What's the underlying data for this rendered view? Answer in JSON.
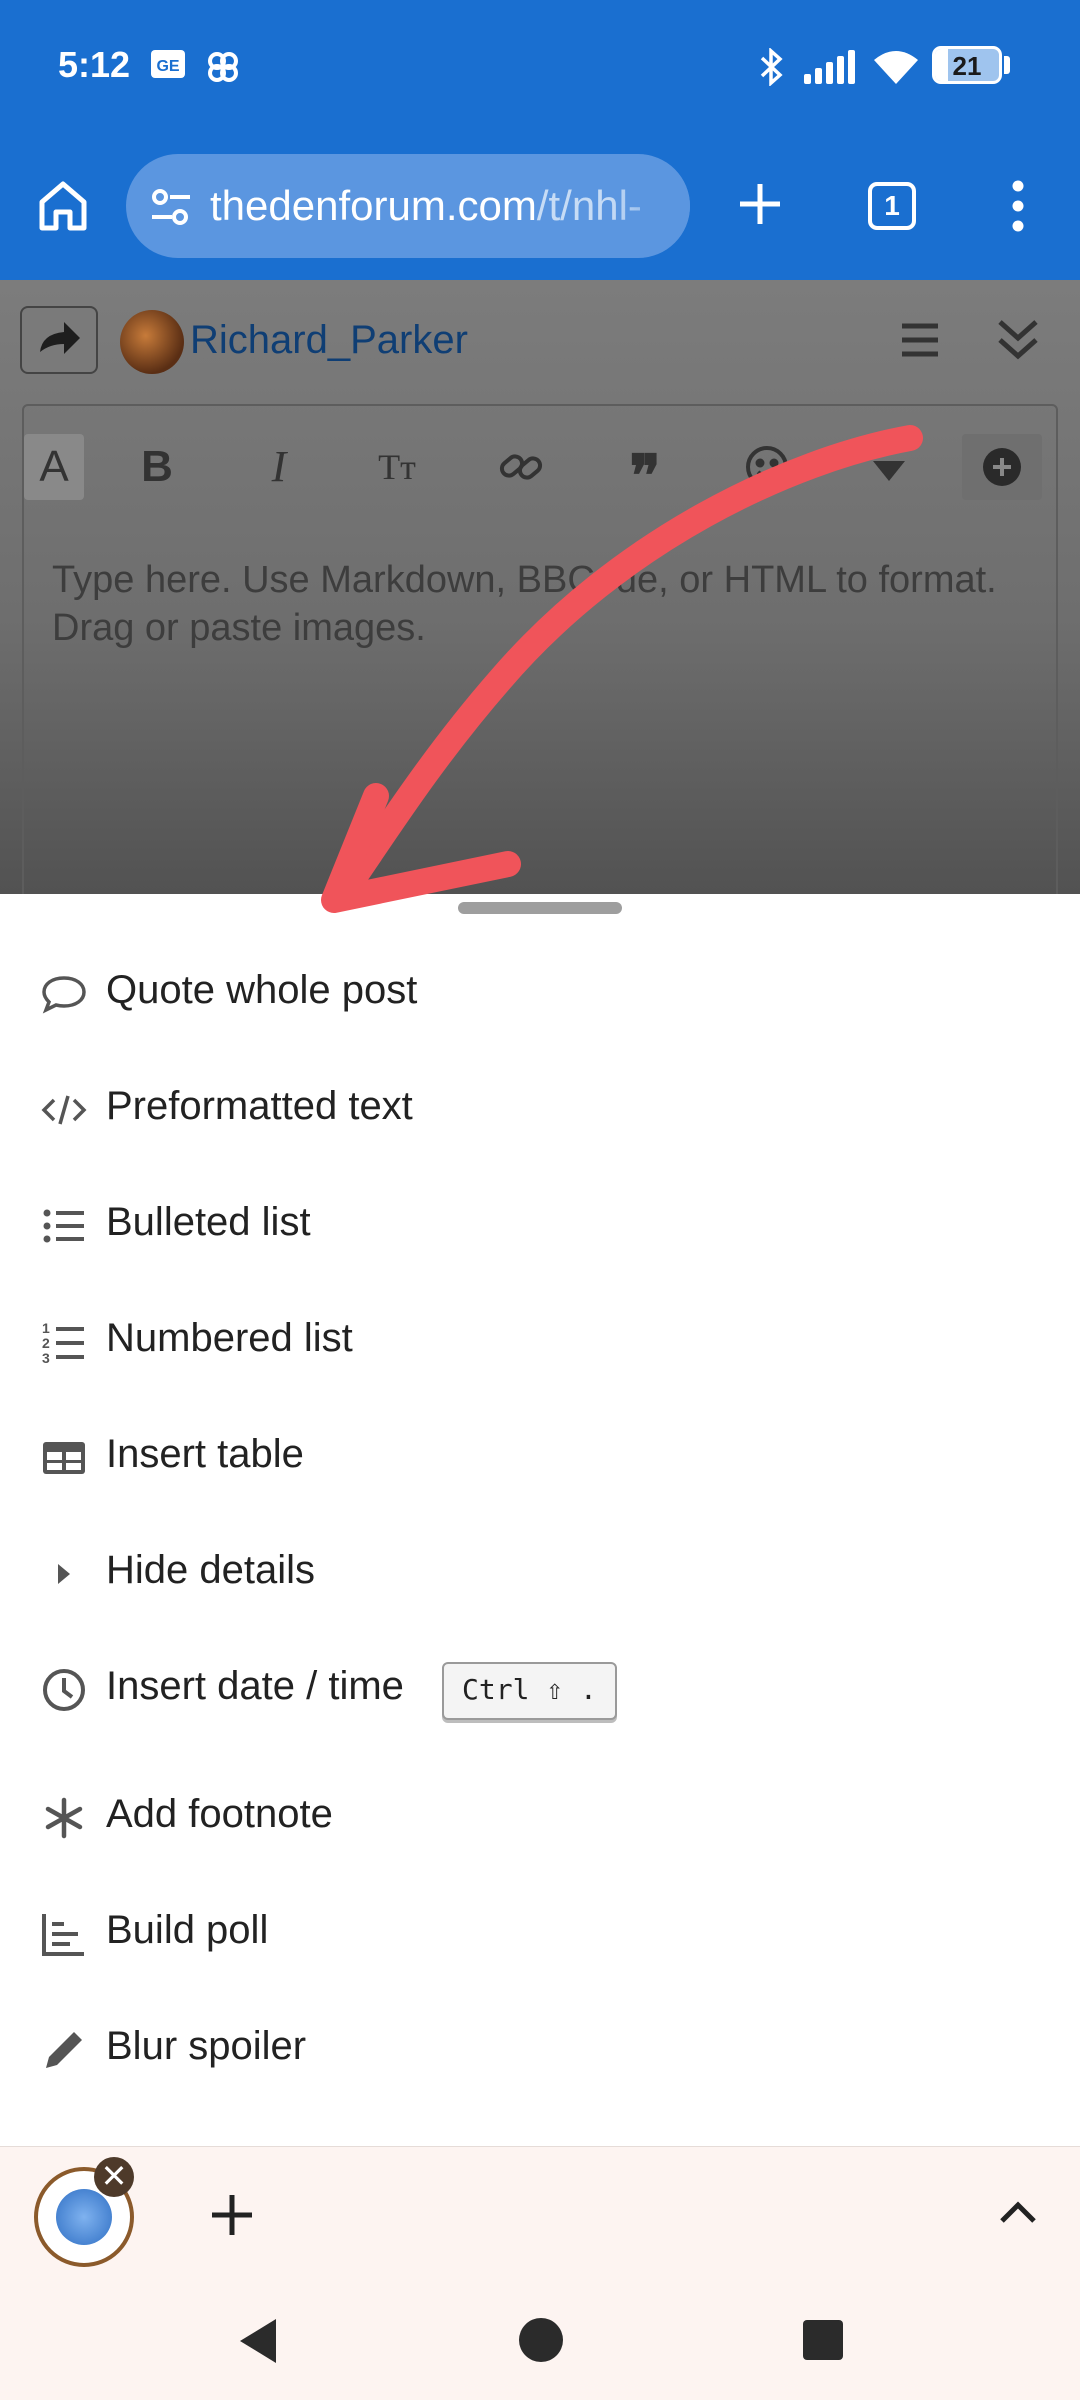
{
  "status_bar": {
    "time": "5:12",
    "battery_level": "21",
    "battery_fraction": 0.21,
    "icons": [
      "gmail-icon",
      "pinwheel-icon",
      "bluetooth-icon",
      "signal-icon",
      "wifi-icon",
      "battery-icon"
    ]
  },
  "browser": {
    "url_domain": "thedenforum.com",
    "url_path": "/t/nhl-",
    "tab_count": "1",
    "colors": {
      "toolbar": "#1a6fd0",
      "urlbar": "#5b96e0"
    }
  },
  "composer": {
    "username": "Richard_Parker",
    "placeholder": "Type here. Use Markdown, BBCode, or HTML to format. Drag or paste images.",
    "toolbar_buttons": [
      "font-size",
      "bold",
      "italic",
      "heading",
      "link",
      "blockquote",
      "emoji",
      "gear",
      "options"
    ]
  },
  "menu": {
    "items": [
      {
        "label": "Quote whole post",
        "icon": "speech-bubble-icon"
      },
      {
        "label": "Preformatted text",
        "icon": "code-icon"
      },
      {
        "label": "Bulleted list",
        "icon": "bulleted-list-icon"
      },
      {
        "label": "Numbered list",
        "icon": "numbered-list-icon"
      },
      {
        "label": "Insert table",
        "icon": "table-icon"
      },
      {
        "label": "Hide details",
        "icon": "caret-right-icon"
      },
      {
        "label": "Insert date / time",
        "icon": "clock-icon",
        "shortcut": "Ctrl ⇧ ."
      },
      {
        "label": "Add footnote",
        "icon": "asterisk-icon"
      },
      {
        "label": "Build poll",
        "icon": "chart-icon"
      },
      {
        "label": "Blur spoiler",
        "icon": "pencil-icon"
      }
    ]
  },
  "annotation": {
    "color": "#f0545a"
  }
}
